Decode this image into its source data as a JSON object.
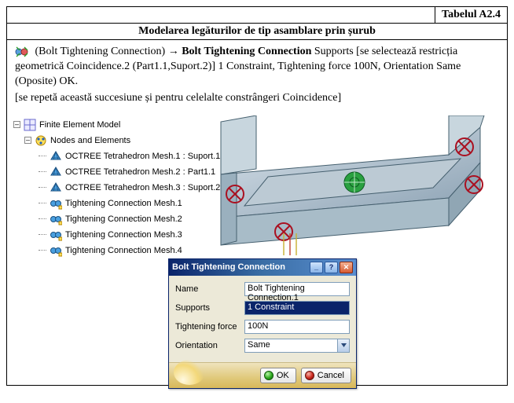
{
  "header": {
    "table_label": "Tabelul A2.4",
    "title": "Modelarea legăturilor de tip asamblare prin șurub"
  },
  "paragraph": {
    "p1a": "(Bolt Tightening Connection) ",
    "arrow": "→",
    "p1b_bold": " Bolt Tightening Connection",
    "p1c": "  Supports [se selectează restricția geometrică Coincidence.2 (Part1.1,Suport.2)] 1 Constraint,  Tightening force 100N, Orientation Same (Oposite) OK.",
    "p2": "[se repetă această succesiune și pentru celelalte constrângeri Coincidence]"
  },
  "tree": {
    "root": "Finite Element Model",
    "nodes_and_elements": "Nodes and Elements",
    "items": [
      "OCTREE Tetrahedron Mesh.1 : Suport.1",
      "OCTREE Tetrahedron Mesh.2 : Part1.1",
      "OCTREE Tetrahedron Mesh.3 : Suport.2",
      "Tightening Connection Mesh.1",
      "Tightening Connection Mesh.2",
      "Tightening Connection Mesh.3",
      "Tightening Connection Mesh.4"
    ]
  },
  "dialog": {
    "title": "Bolt Tightening Connection",
    "labels": {
      "name": "Name",
      "supports": "Supports",
      "force": "Tightening force",
      "orientation": "Orientation"
    },
    "values": {
      "name": "Bolt Tightening Connection.1",
      "supports": "1 Constraint",
      "force": "100N",
      "orientation": "Same"
    },
    "buttons": {
      "ok": "OK",
      "cancel": "Cancel"
    }
  }
}
